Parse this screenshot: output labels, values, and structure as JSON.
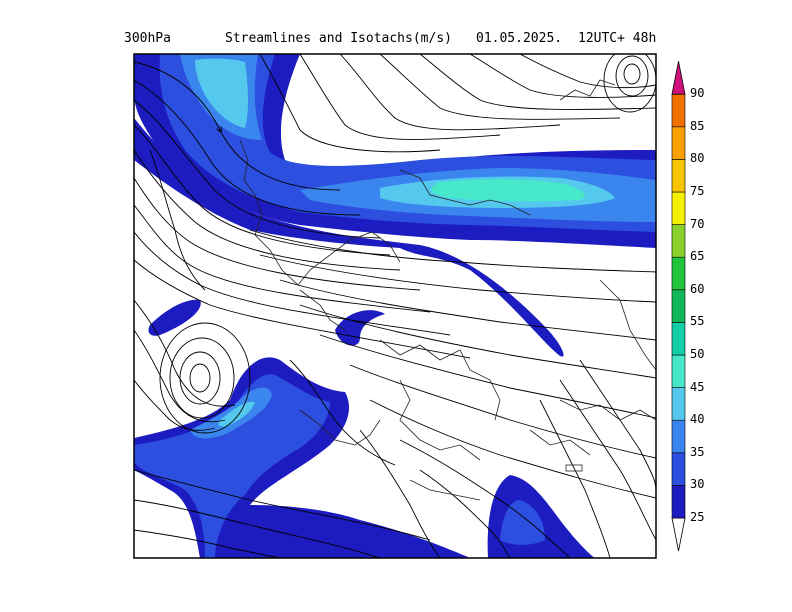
{
  "header": {
    "level": "300hPa",
    "title": "Streamlines and Isotachs(m/s)",
    "date": "01.05.2025.",
    "run": "12UTC+ 48h"
  },
  "colorbar": {
    "levels": [
      "25",
      "30",
      "35",
      "40",
      "45",
      "50",
      "55",
      "60",
      "65",
      "70",
      "75",
      "80",
      "85",
      "90"
    ],
    "colors": [
      "#1c1cc0",
      "#2c4fe0",
      "#3b86ee",
      "#55c8ee",
      "#46e8c9",
      "#13cfa8",
      "#12b75c",
      "#22c43c",
      "#8ad02c",
      "#f4f000",
      "#f8c400",
      "#f8a000",
      "#f07000",
      "#b00040",
      "#d0107c"
    ]
  }
}
